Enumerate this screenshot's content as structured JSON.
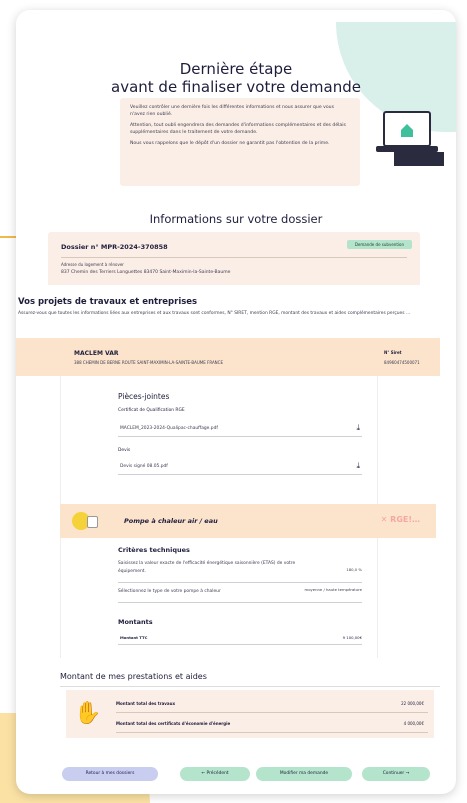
{
  "header": {
    "title_line1": "Dernière étape",
    "title_line2": "avant de finaliser votre demande"
  },
  "intro": {
    "p1": "Veuillez contrôler une dernière fois les différentes informations et nous assurer que vous n'avez rien oublié.",
    "p2": "Attention, tout oubli engendrera des demandes d'informations complémentaires et des délais supplémentaires dans le traitement de votre demande.",
    "p3": "Nous vous rappelons que le dépôt d'un dossier ne garantit pas l'obtention de la prime."
  },
  "dossier_section": {
    "heading": "Informations sur votre dossier",
    "dossier_label": "Dossier n° MPR-2024-370858",
    "status_badge": "Demande de subvention",
    "address_label": "Adresse du logement à rénover",
    "address_value": "837 Chemin des Terriers Longuettes 83470 Saint-Maximin-la-Sainte-Baume"
  },
  "projects": {
    "heading": "Vos projets de travaux et entreprises",
    "description": "Assurez-vous que toutes les informations liées aux entreprises et aux travaux sont conformes, N° SIRET, mention RGE, montant des travaux et aides complémentaires perçues ..."
  },
  "company": {
    "name": "MACLEM VAR",
    "address": "388 CHEMIN DE BERNE ROUTE SAINT-MAXIMIN-LA-SAINTE-BAUME FRANCE",
    "siret_label": "N° Siret",
    "siret_value": "84960474500071"
  },
  "attachments": {
    "heading": "Pièces-jointes",
    "cert_label": "Certificat de Qualification RGE",
    "cert_file": "MACLEM_2023-2024-Qualipac-chauffage.pdf",
    "devis_label": "Devis",
    "devis_file": "Devis signé 08.05.pdf"
  },
  "work": {
    "name": "Pompe à chaleur air / eau",
    "rge_tag": "✕ RGE!…"
  },
  "criteria": {
    "heading": "Critères techniques",
    "row1_label": "Saisissez la valeur exacte de l'efficacité énergétique saisonnière (ETAS) de votre équipement.",
    "row1_value": "180,0 %",
    "row2_label": "Sélectionnez le type de votre pompe à chaleur",
    "row2_value": "moyenne / haute température"
  },
  "amounts": {
    "heading": "Montants",
    "ttc_label": "Montant TTC",
    "ttc_value": "9 100,00€"
  },
  "summary": {
    "heading": "Montant de mes prestations et aides",
    "row1_label": "Montant total des travaux",
    "row1_value": "22 000,00€",
    "row2_label": "Montant total des certificats d'économie d'énergie",
    "row2_value": "4 000,00€"
  },
  "buttons": {
    "back": "Retour à mes dossiers",
    "previous": "← Précédent",
    "modify": "Modifier ma demande",
    "continue": "Continuer →"
  },
  "icons": {
    "laptop": "laptop-house-icon",
    "download": "download-icon",
    "heat_pump": "heat-pump-icon",
    "piggy": "hand-coin-icon"
  },
  "colors": {
    "accent_green": "#b5e4cc",
    "accent_blue": "#c9cdf0",
    "warm_panel": "#fbeee6",
    "orange_panel": "#fbe3cc"
  }
}
